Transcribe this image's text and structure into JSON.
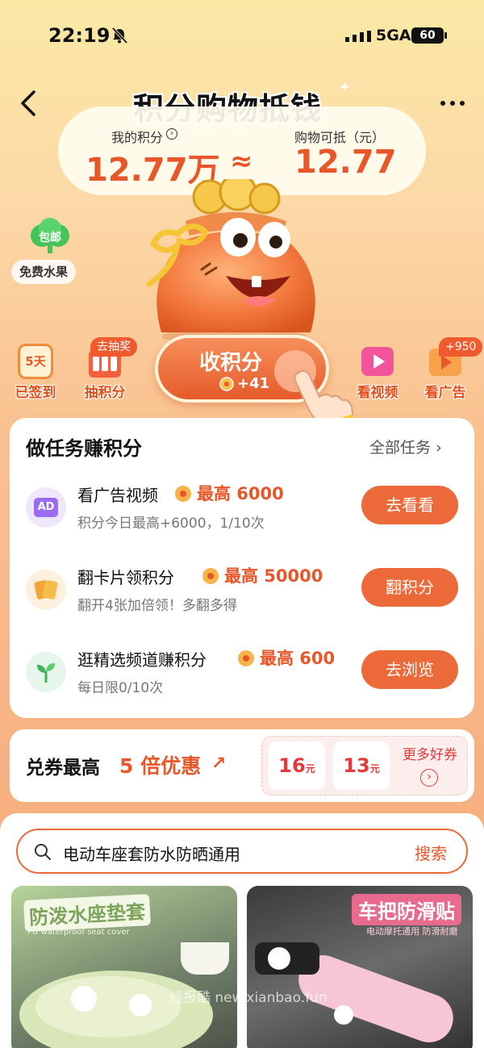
{
  "status": {
    "time": "22:19",
    "network": "5GA",
    "battery": "60"
  },
  "header": {
    "title": "积分购物抵钱"
  },
  "points": {
    "my_points_label": "我的积分",
    "my_points_value": "12.77万",
    "approx": "≈",
    "deduct_label": "购物可抵（元）",
    "deduct_value": "12.77"
  },
  "side_promo": {
    "badge": "包邮",
    "label": "免费水果"
  },
  "actions": [
    {
      "label": "已签到",
      "icon_text": "5天"
    },
    {
      "label": "抽积分",
      "badge": "去抽奖"
    },
    {
      "label": "看视频"
    },
    {
      "label": "看广告",
      "badge": "+950"
    }
  ],
  "collect": {
    "title": "收积分",
    "sub": "+41"
  },
  "tasks": {
    "title": "做任务赚积分",
    "all_label": "全部任务",
    "items": [
      {
        "icon_text": "AD",
        "name": "看广告视频",
        "reward": "最高 6000",
        "desc": "积分今日最高+6000，1/10次",
        "button": "去看看"
      },
      {
        "name": "翻卡片领积分",
        "reward": "最高 50000",
        "desc": "翻开4张加倍领！多翻多得",
        "button": "翻积分"
      },
      {
        "name": "逛精选频道赚积分",
        "reward": "最高 600",
        "desc": "每日限0/10次",
        "button": "去浏览"
      }
    ]
  },
  "coupons": {
    "title": "兑券最高",
    "highlight": "5 倍优惠",
    "tiles": [
      {
        "value": "16",
        "unit": "元"
      },
      {
        "value": "13",
        "unit": "元"
      }
    ],
    "more": "更多好券"
  },
  "search": {
    "query": "电动车座套防水防晒通用",
    "button": "搜索"
  },
  "products": [
    {
      "label": "防泼水座垫套",
      "sub": "PU waterproof seat cover"
    },
    {
      "label": "车把防滑贴",
      "sub": "电动摩托通用 防滑耐磨"
    }
  ],
  "watermark": "线报酷 new.xianbao.fun",
  "colors": {
    "accent": "#e8572a",
    "button": "#ec6a3a"
  }
}
